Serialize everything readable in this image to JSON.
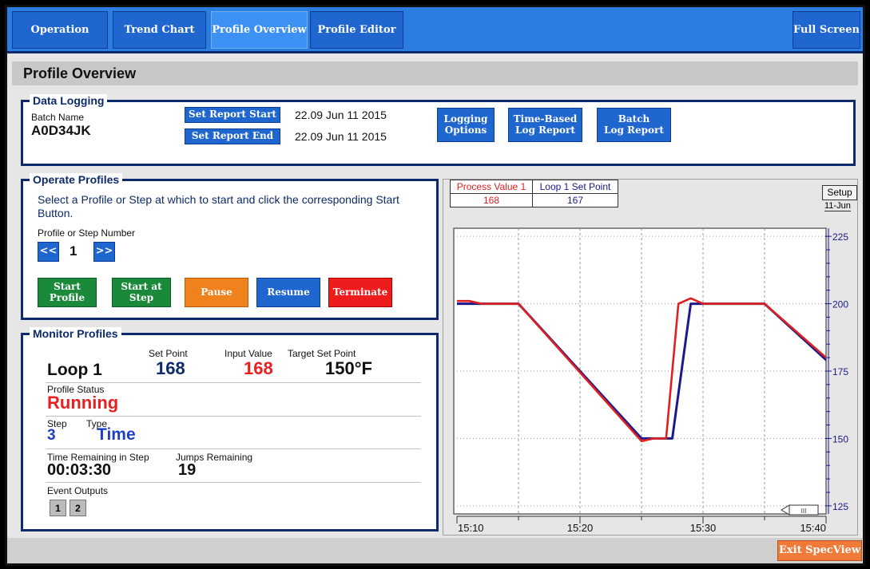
{
  "nav": {
    "tabs": [
      "Operation",
      "Trend Chart",
      "Profile Overview",
      "Profile Editor"
    ],
    "full_screen": "Full Screen"
  },
  "page_title": "Profile Overview",
  "data_logging": {
    "legend": "Data Logging",
    "batch_label": "Batch Name",
    "batch_name": "A0D34JK",
    "set_report_start": "Set Report Start",
    "set_report_end": "Set Report End",
    "report_start": "22.09 Jun 11 2015",
    "report_end": "22.09 Jun 11 2015",
    "logging_options": [
      "Logging",
      "Options"
    ],
    "time_based": [
      "Time-Based",
      "Log Report"
    ],
    "batch_report": [
      "Batch",
      "Log Report"
    ]
  },
  "operate": {
    "legend": "Operate Profiles",
    "instruction": "Select a Profile or Step at which to start and click the corresponding Start Button.",
    "step_label": "Profile or Step Number",
    "prev": "<<",
    "next": ">>",
    "step_number": "1",
    "start_profile": [
      "Start",
      "Profile"
    ],
    "start_at_step": [
      "Start at",
      "Step"
    ],
    "pause": "Pause",
    "resume": "Resume",
    "terminate": "Terminate"
  },
  "monitor": {
    "legend": "Monitor Profiles",
    "loop": "Loop 1",
    "set_point_label": "Set Point",
    "set_point": "168",
    "input_label": "Input Value",
    "input_value": "168",
    "target_label": "Target Set Point",
    "target": "150°F",
    "status_label": "Profile Status",
    "status": "Running",
    "step_label": "Step",
    "step": "3",
    "type_label": "Type",
    "type": "Time",
    "time_label": "Time Remaining in Step",
    "time_remaining": "00:03:30",
    "jumps_label": "Jumps Remaining",
    "jumps": "19",
    "event_label": "Event Outputs",
    "events": [
      "1",
      "2"
    ]
  },
  "chart": {
    "pv_label": "Process Value 1",
    "pv_value": "168",
    "sp_label": "Loop 1 Set Point",
    "sp_value": "167",
    "setup": "Setup",
    "date": "11-Jun",
    "scroll_label": "III"
  },
  "chart_data": {
    "type": "line",
    "x_ticks": [
      "15:10",
      "15:20",
      "15:30",
      "15:40"
    ],
    "y_ticks": [
      225,
      200,
      175,
      150,
      125
    ],
    "ylim": [
      122,
      228
    ],
    "series": [
      {
        "name": "Process Value 1",
        "color": "#e02020",
        "points": [
          [
            "15:10",
            201
          ],
          [
            "15:11",
            201
          ],
          [
            "15:12",
            200
          ],
          [
            "15:14",
            200
          ],
          [
            "15:15",
            200
          ],
          [
            "15:25",
            149
          ],
          [
            "15:26",
            150
          ],
          [
            "15:27",
            150
          ],
          [
            "15:28",
            200
          ],
          [
            "15:29",
            202
          ],
          [
            "15:30",
            200
          ],
          [
            "15:35",
            200
          ],
          [
            "15:41",
            176
          ]
        ]
      },
      {
        "name": "Loop 1 Set Point",
        "color": "#1a1a8c",
        "points": [
          [
            "15:10",
            200
          ],
          [
            "15:15",
            200
          ],
          [
            "15:25",
            150
          ],
          [
            "15:27.5",
            150
          ],
          [
            "15:29",
            200
          ],
          [
            "15:35",
            200
          ],
          [
            "15:41",
            175
          ]
        ]
      }
    ]
  },
  "exit_button": "Exit SpecView"
}
